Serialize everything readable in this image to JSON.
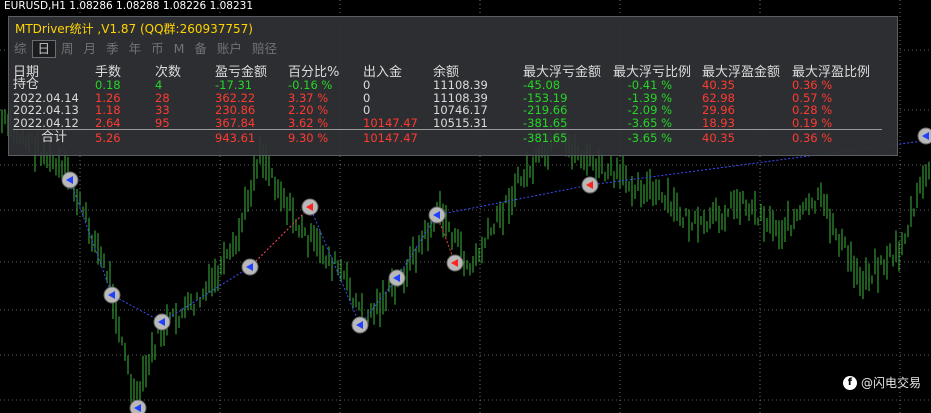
{
  "chart": {
    "symbol_line": "EURUSD,H1  1.08286 1.08288 1.08226 1.08231",
    "candle_color": "#3cb83c",
    "background": "#000000",
    "grid_color": "#ffffff"
  },
  "panel": {
    "title": "MTDriver统计 ,V1.87 (QQ群:260937757)",
    "tabs": [
      "综",
      "日",
      "周",
      "月",
      "季",
      "年",
      "币",
      "M",
      "备",
      "账户",
      "赔径"
    ],
    "active_tab": "日",
    "headers": [
      "日期",
      "手数",
      "次数",
      "盈亏金额",
      "百分比%",
      "出入金",
      "余额",
      "最大浮亏金额",
      "最大浮亏比例",
      "最大浮盈金额",
      "最大浮盈比例"
    ],
    "rows": [
      [
        "持仓",
        "0.18",
        "4",
        "-17.31",
        "-0.16 %",
        "0",
        "11108.39",
        "-45.08",
        "-0.41 %",
        "40.35",
        "0.36 %"
      ],
      [
        "2022.04.14",
        "1.26",
        "28",
        "362.22",
        "3.37 %",
        "0",
        "11108.39",
        "-153.19",
        "-1.39 %",
        "62.98",
        "0.57 %"
      ],
      [
        "2022.04.13",
        "1.18",
        "33",
        "230.86",
        "2.20 %",
        "0",
        "10746.17",
        "-219.66",
        "-2.09 %",
        "29.96",
        "0.28 %"
      ],
      [
        "2022.04.12",
        "2.64",
        "95",
        "367.84",
        "3.62 %",
        "10147.47",
        "10515.31",
        "-381.65",
        "-3.65 %",
        "18.93",
        "0.19 %"
      ]
    ],
    "total": [
      "合计",
      "5.26",
      "",
      "943.61",
      "9.30 %",
      "10147.47",
      "",
      "-381.65",
      "-3.65 %",
      "40.35",
      "0.36 %"
    ]
  },
  "watermark": {
    "text": "@闪电交易",
    "icon": "facebook-icon"
  }
}
